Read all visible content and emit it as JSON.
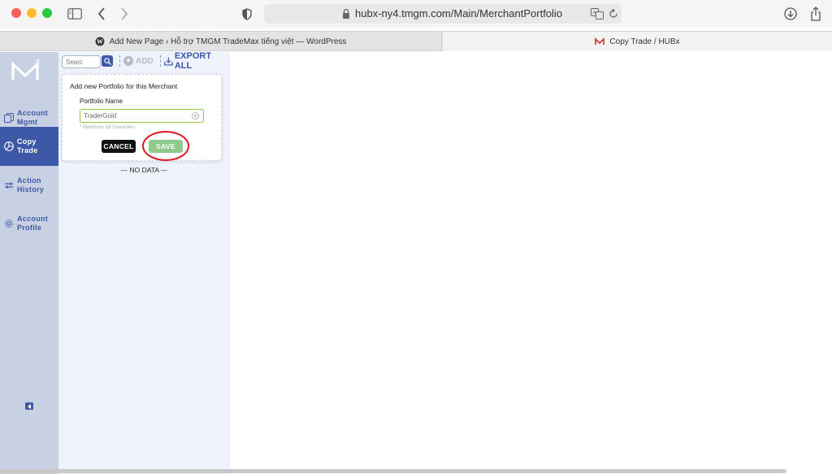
{
  "browser": {
    "url": "hubx-ny4.tmgm.com/Main/MerchantPortfolio",
    "tabs": [
      {
        "label": "Add New Page ‹ Hỗ trợ TMGM TradeMax tiếng việt — WordPress",
        "icon": "wordpress-icon"
      },
      {
        "label": "Copy Trade / HUBx",
        "icon": "tmgm-icon"
      }
    ]
  },
  "sidebar": {
    "accent": "#3c58a6",
    "items": [
      {
        "line1": "Account",
        "line2": "Mgmt",
        "icon": "copy-icon"
      },
      {
        "line1": "Copy",
        "line2": "Trade",
        "icon": "pie-icon",
        "active": true
      },
      {
        "line1": "Action",
        "line2": "History",
        "icon": "sliders-icon"
      },
      {
        "line1": "Account",
        "line2": "Profile",
        "icon": "gear-icon"
      }
    ]
  },
  "toolbar": {
    "search_placeholder": "Searc",
    "add_label": "ADD",
    "export_label": "EXPORT ALL"
  },
  "popup": {
    "title": "Add new Portfolio for this Merchant",
    "field_label": "Portfolio Name",
    "field_value": "TraderGold",
    "hint": "* Maximum 18 characters",
    "cancel_label": "CANCEL",
    "save_label": "SAVE"
  },
  "list": {
    "empty_text": "--- NO DATA ---"
  }
}
